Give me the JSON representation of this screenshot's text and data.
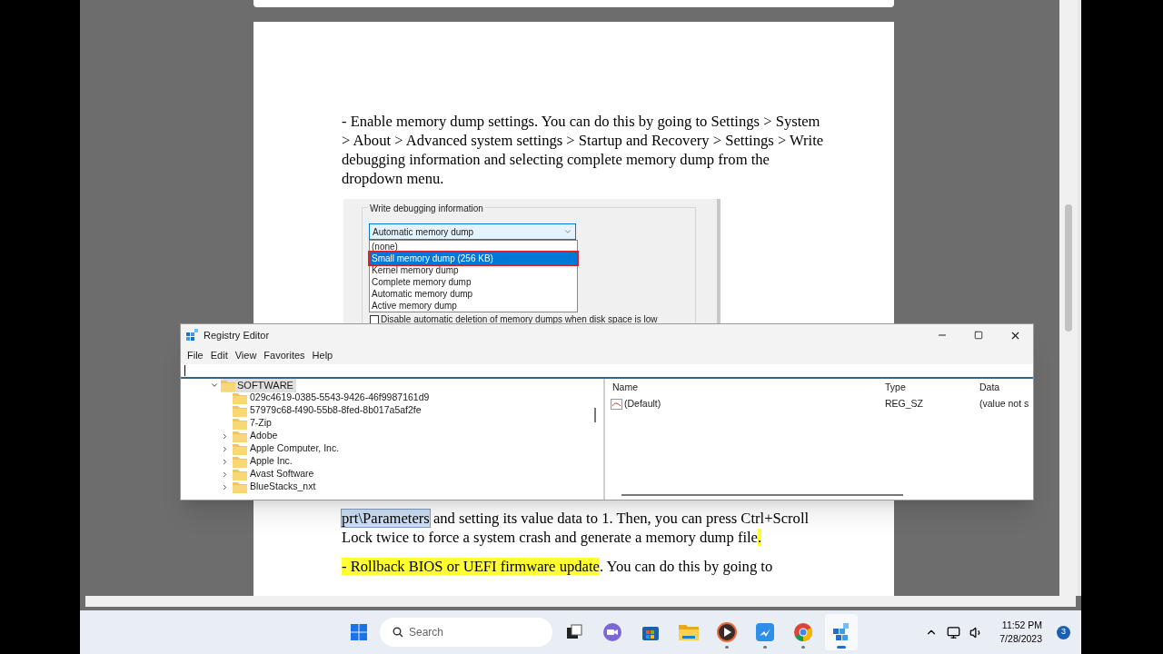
{
  "document": {
    "paragraph_1": "- Enable memory dump settings. You can do this by going to Settings > System > About > Advanced system settings > Startup and Recovery > Settings > Write debugging information and selecting complete memory dump from the dropdown menu.",
    "embedded_dialog": {
      "group_label": "Write debugging information",
      "combo_value": "Automatic memory dump",
      "options": [
        {
          "label": "(none)",
          "selected": false
        },
        {
          "label": "Small memory dump (256 KB)",
          "selected": true
        },
        {
          "label": "Kernel memory dump",
          "selected": false
        },
        {
          "label": "Complete memory dump",
          "selected": false
        },
        {
          "label": "Automatic memory dump",
          "selected": false
        },
        {
          "label": "Active memory dump",
          "selected": false
        }
      ],
      "checkbox": {
        "label": "Disable automatic deletion of memory dumps when disk space is low",
        "checked": false
      }
    },
    "paragraph_2": [
      {
        "text": "prt\\Parameters",
        "kind": "selection"
      },
      {
        "text": " and setting its value data to 1. Then, you can press Ctrl+Scroll Lock twice to force a system crash and generate a memory dump file",
        "kind": "plain"
      },
      {
        "text": ".",
        "kind": "highlight"
      }
    ],
    "paragraph_3": [
      {
        "text": "- Rollback BIOS or UEFI firmware update",
        "kind": "highlight"
      },
      {
        "text": ". You can do this by going to",
        "kind": "plain"
      }
    ]
  },
  "registry_editor": {
    "title": "Registry Editor",
    "menu": [
      "File",
      "Edit",
      "View",
      "Favorites",
      "Help"
    ],
    "tree": [
      {
        "label": "SOFTWARE",
        "expanded": true,
        "selected": true,
        "children": [
          {
            "label": "029c4619-0385-5543-9426-46f9987161d9",
            "expandable": false
          },
          {
            "label": "57979c68-f490-55b8-8fed-8b017a5af2fe",
            "expandable": false
          },
          {
            "label": "7-Zip",
            "expandable": false
          },
          {
            "label": "Adobe",
            "expandable": true
          },
          {
            "label": "Apple Computer, Inc.",
            "expandable": true
          },
          {
            "label": "Apple Inc.",
            "expandable": true
          },
          {
            "label": "Avast Software",
            "expandable": true
          },
          {
            "label": "BlueStacks_nxt",
            "expandable": true
          }
        ]
      }
    ],
    "columns": [
      "Name",
      "Type",
      "Data"
    ],
    "rows": [
      {
        "name": "(Default)",
        "type": "REG_SZ",
        "data": "(value not s"
      }
    ]
  },
  "taskbar": {
    "search_placeholder": "Search",
    "apps": [
      {
        "kind": "task-view",
        "running": false,
        "active": false
      },
      {
        "kind": "chat",
        "running": false,
        "active": false
      },
      {
        "kind": "store",
        "running": false,
        "active": false
      },
      {
        "kind": "explorer",
        "running": false,
        "active": false
      },
      {
        "kind": "player",
        "running": true,
        "active": false
      },
      {
        "kind": "messenger",
        "running": true,
        "active": false
      },
      {
        "kind": "browser",
        "running": true,
        "active": false
      },
      {
        "kind": "registry",
        "running": true,
        "active": true
      }
    ],
    "time": "11:52 PM",
    "date": "7/28/2023",
    "notifications": "3"
  }
}
